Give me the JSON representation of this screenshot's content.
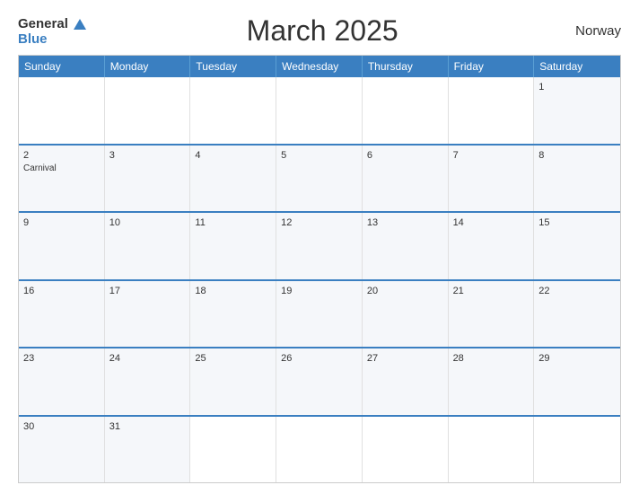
{
  "header": {
    "logo_general": "General",
    "logo_blue": "Blue",
    "title": "March 2025",
    "country": "Norway"
  },
  "calendar": {
    "days_of_week": [
      "Sunday",
      "Monday",
      "Tuesday",
      "Wednesday",
      "Thursday",
      "Friday",
      "Saturday"
    ],
    "weeks": [
      [
        {
          "day": "",
          "event": ""
        },
        {
          "day": "",
          "event": ""
        },
        {
          "day": "",
          "event": ""
        },
        {
          "day": "",
          "event": ""
        },
        {
          "day": "",
          "event": ""
        },
        {
          "day": "",
          "event": ""
        },
        {
          "day": "1",
          "event": ""
        }
      ],
      [
        {
          "day": "2",
          "event": "Carnival"
        },
        {
          "day": "3",
          "event": ""
        },
        {
          "day": "4",
          "event": ""
        },
        {
          "day": "5",
          "event": ""
        },
        {
          "day": "6",
          "event": ""
        },
        {
          "day": "7",
          "event": ""
        },
        {
          "day": "8",
          "event": ""
        }
      ],
      [
        {
          "day": "9",
          "event": ""
        },
        {
          "day": "10",
          "event": ""
        },
        {
          "day": "11",
          "event": ""
        },
        {
          "day": "12",
          "event": ""
        },
        {
          "day": "13",
          "event": ""
        },
        {
          "day": "14",
          "event": ""
        },
        {
          "day": "15",
          "event": ""
        }
      ],
      [
        {
          "day": "16",
          "event": ""
        },
        {
          "day": "17",
          "event": ""
        },
        {
          "day": "18",
          "event": ""
        },
        {
          "day": "19",
          "event": ""
        },
        {
          "day": "20",
          "event": ""
        },
        {
          "day": "21",
          "event": ""
        },
        {
          "day": "22",
          "event": ""
        }
      ],
      [
        {
          "day": "23",
          "event": ""
        },
        {
          "day": "24",
          "event": ""
        },
        {
          "day": "25",
          "event": ""
        },
        {
          "day": "26",
          "event": ""
        },
        {
          "day": "27",
          "event": ""
        },
        {
          "day": "28",
          "event": ""
        },
        {
          "day": "29",
          "event": ""
        }
      ],
      [
        {
          "day": "30",
          "event": ""
        },
        {
          "day": "31",
          "event": ""
        },
        {
          "day": "",
          "event": ""
        },
        {
          "day": "",
          "event": ""
        },
        {
          "day": "",
          "event": ""
        },
        {
          "day": "",
          "event": ""
        },
        {
          "day": "",
          "event": ""
        }
      ]
    ]
  }
}
